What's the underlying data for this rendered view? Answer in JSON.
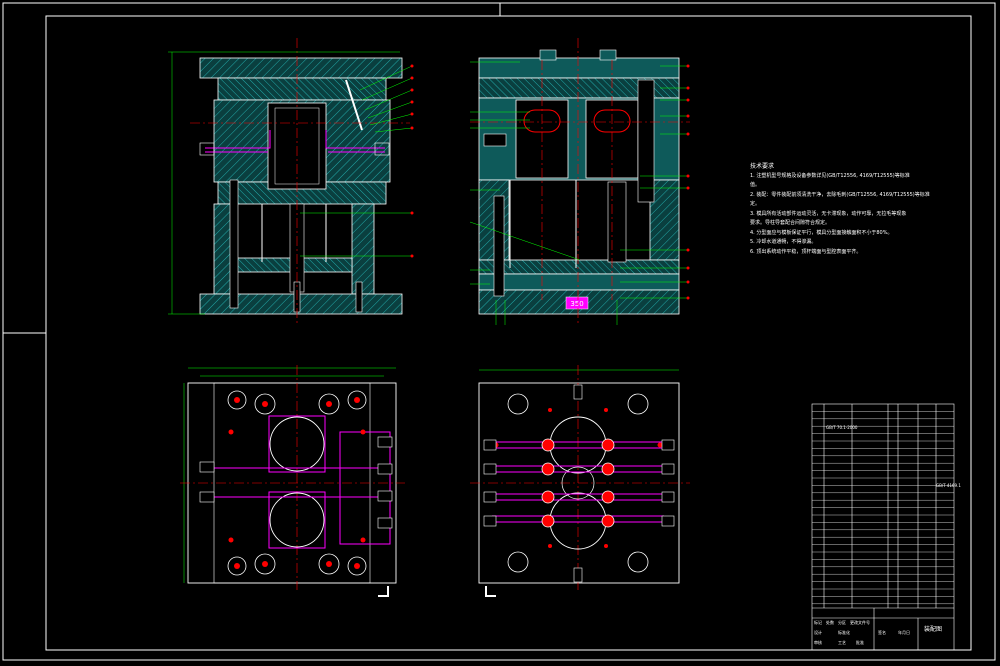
{
  "drawing": {
    "colors": {
      "background": "#000000",
      "frame": "#ffffff",
      "outline": "#ffffff",
      "hatch": "#00c0c0",
      "plate_fill": "#0e5a5a",
      "center_line": "#ff0000",
      "leader": "#00ff00",
      "cooling": "#ff00ff",
      "dimension": "#00ff00",
      "balloon": "#ffff00"
    },
    "stamp_label": "350",
    "tech_requirements": {
      "title": "技术要求",
      "lines": [
        "1. 注塑机型号规格及设备参数详见(GB/T12556, 4169/T12555)等标准",
        "值。",
        "2. 装配：零件装配前须清洗干净，去除毛刺(GB/T12556, 4169/T12555)等标准",
        "定。",
        "3. 模具所有活动部件运动灵活，无卡滞现象，动作可靠，无拉毛等现象",
        "要求。导柱导套配合间隙符合规定。",
        "4. 分型面应与模板保证平行，模具分型面接触面积不小于80%。",
        "5. 冷却水道通畅，不得渗漏。",
        "6. 顶出系统动作平稳，顶杆端面与型腔表面平齐。"
      ]
    },
    "title_block": {
      "name": "装配图",
      "cells": [
        "标记",
        "处数",
        "分区",
        "更改文件号",
        "签名",
        "年月日",
        "设计",
        "标准化",
        "阶段标记",
        "重量",
        "比例",
        "审核",
        "工艺",
        "批准"
      ]
    },
    "bom_notes": [
      "GB/T 70.1-2000",
      "GB/T 4169.1"
    ]
  }
}
